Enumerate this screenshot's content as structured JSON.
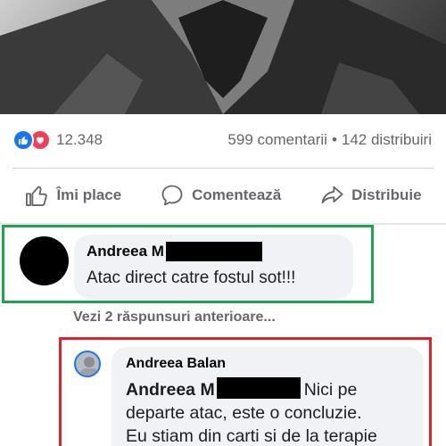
{
  "reactions": {
    "count": "12.348",
    "comments": "599 comentarii",
    "separator": "•",
    "shares": "142 distribuiri",
    "icons": [
      "like-icon",
      "love-icon"
    ]
  },
  "actions": {
    "like": "Îmi place",
    "comment": "Comentează",
    "share": "Distribuie"
  },
  "comment1": {
    "author": "Andreea M",
    "text": "Atac direct catre fostul sot!!!"
  },
  "view_previous": "Vezi 2 răspunsuri anterioare...",
  "reply": {
    "author": "Andreea Balan",
    "mention": "Andreea M",
    "text_line1": "Nici pe",
    "text_line2": "departe atac, este o concluzie.",
    "text_line3": "Eu stiam din carti si de la terapie"
  },
  "colors": {
    "highlight_green": "#1ea44b",
    "highlight_red": "#e0212b",
    "facebook_blue": "#1877f2"
  }
}
